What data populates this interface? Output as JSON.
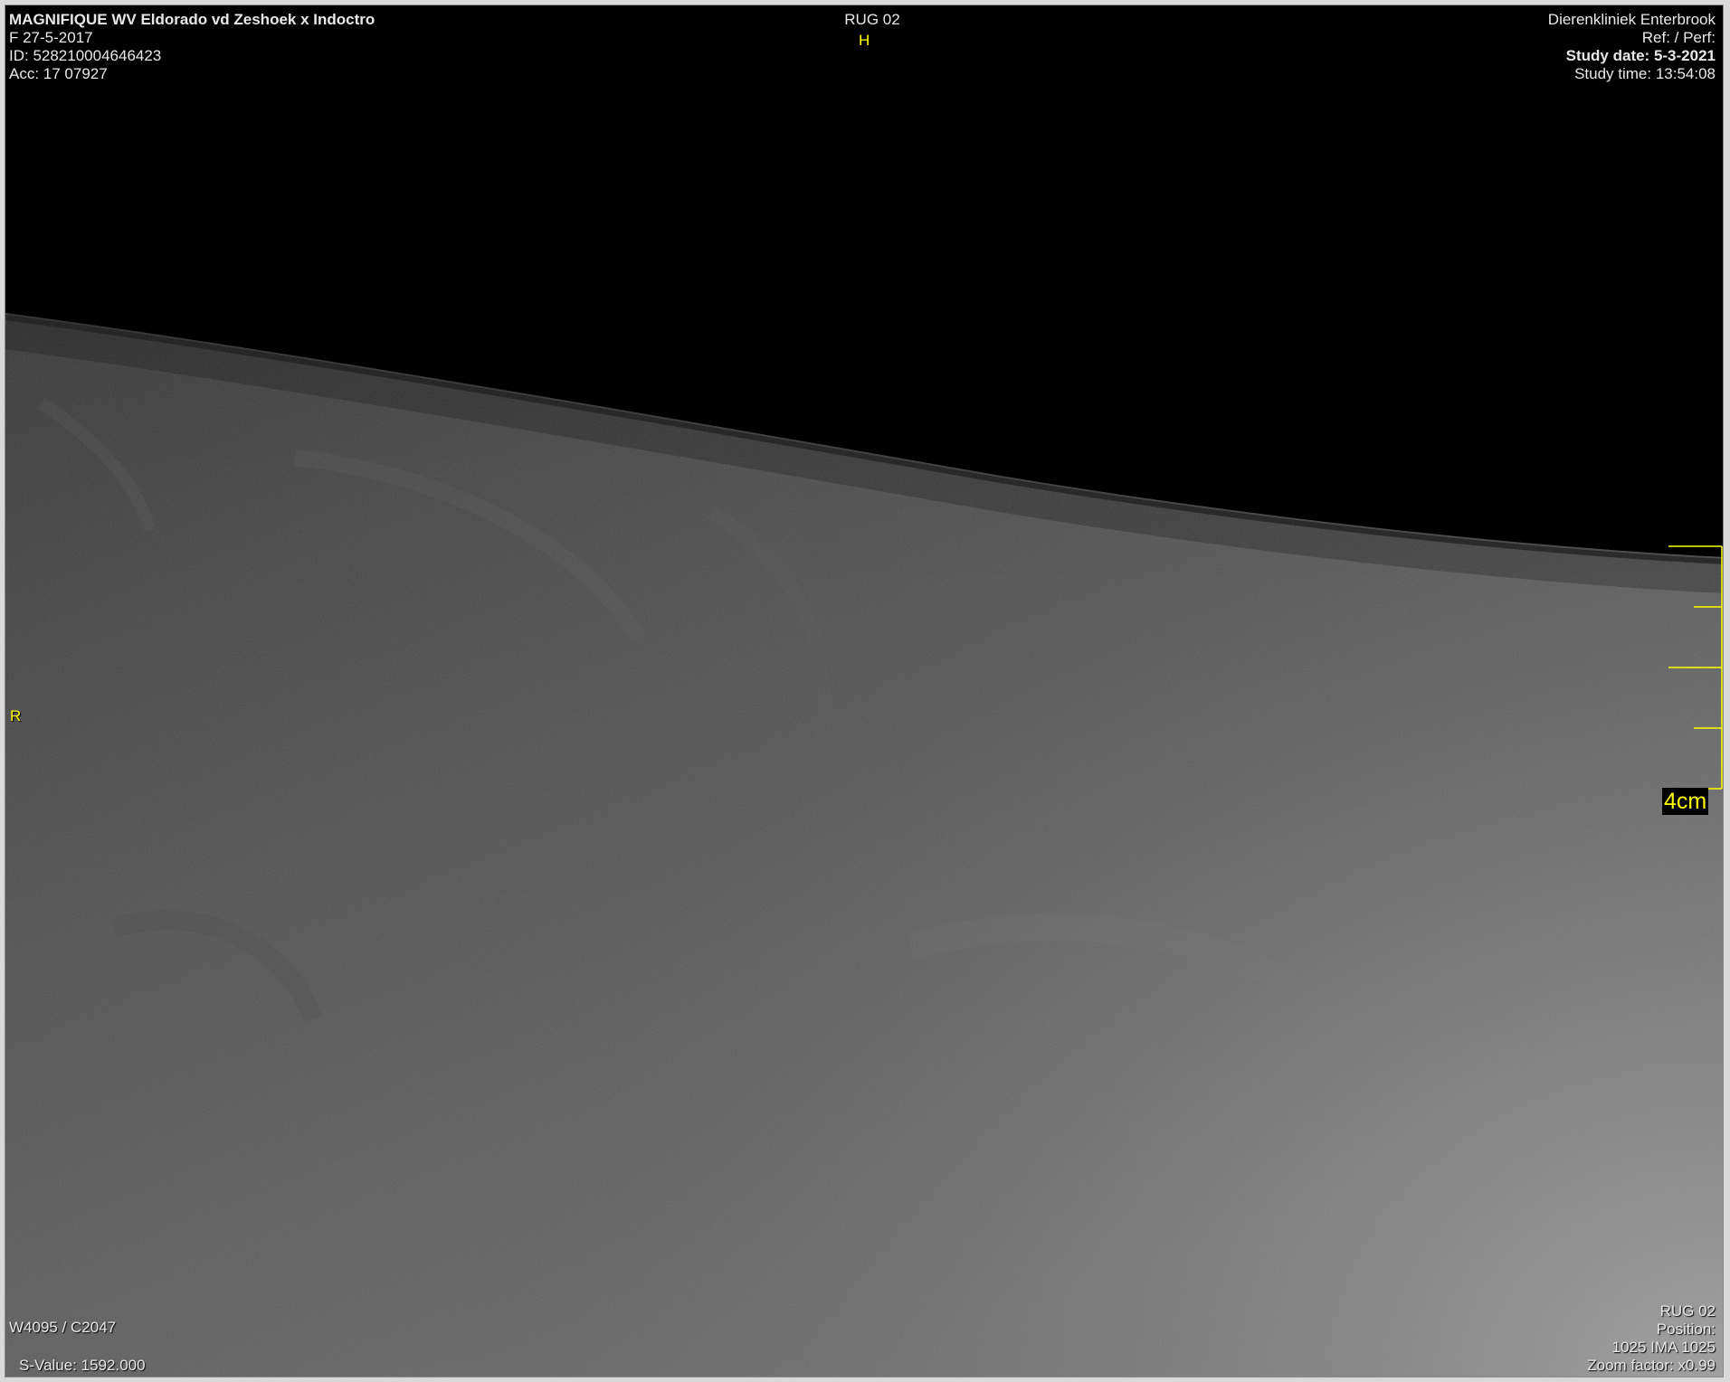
{
  "overlay": {
    "top_left": {
      "patient_name": "MAGNIFIQUE WV  Eldorado vd Zeshoek x Indoctro",
      "sex_dob": "F  27-5-2017",
      "patient_id": "ID: 528210004646423",
      "accession": "Acc: 17 07927"
    },
    "top_center": {
      "series": "RUG 02",
      "orientation_top": "H"
    },
    "top_right": {
      "institution": "Dierenkliniek Enterbrook",
      "ref_perf": "Ref:  / Perf:",
      "study_date": "Study date: 5-3-2021",
      "study_time": "Study time: 13:54:08"
    },
    "left_side": {
      "orientation_left": "R"
    },
    "bottom_left": {
      "window_level": "W4095 / C2047",
      "s_value": "S-Value: 1592.000"
    },
    "bottom_right": {
      "series": "RUG 02",
      "position": "Position:",
      "image_index": "1025 IMA 1025",
      "zoom": "Zoom factor: x0.99"
    },
    "scale": {
      "label": "4cm"
    }
  },
  "colors": {
    "overlay_text": "#e8e8e8",
    "annotation": "#ffff00",
    "background": "#000000",
    "frame": "#d9d9d9"
  }
}
